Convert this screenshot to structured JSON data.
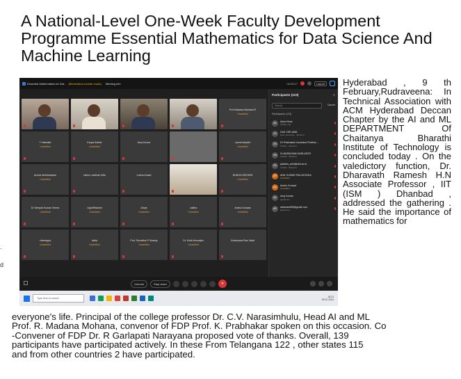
{
  "title": "A National-Level One-Week Faculty Development Programme Essential Mathematics for Data Science And Machine Learning",
  "left_margin_marks": [
    ".",
    "d"
  ],
  "meeting": {
    "window_title": "Essential Mathematics for Dat...",
    "unmute_mode": "(Moderated unmute mode)",
    "meeting_info": "Meeting info",
    "time": "02:03:17",
    "layout_label": "Layout",
    "tiles": [
      {
        "name": "",
        "status": "",
        "kind": "v1"
      },
      {
        "name": "",
        "status": "",
        "kind": "v2"
      },
      {
        "name": "",
        "status": "",
        "kind": "v3"
      },
      {
        "name": "",
        "status": "",
        "kind": "v4"
      },
      {
        "name": "Prof Madana Mohana R",
        "status": "Unverified",
        "kind": "highlight"
      },
      {
        "name": "Y Harinath",
        "status": "Unverified",
        "kind": ""
      },
      {
        "name": "Krupa Suthar",
        "status": "Unverified",
        "kind": ""
      },
      {
        "name": "Anuj Kumar",
        "status": "",
        "kind": ""
      },
      {
        "name": "",
        "status": "",
        "kind": "gray"
      },
      {
        "name": "Laxmi deepthi",
        "status": "Unverified",
        "kind": ""
      },
      {
        "name": "Arunia Mokhanaram",
        "status": "Unverified",
        "kind": ""
      },
      {
        "name": "vishnu vardhan bittu",
        "status": "",
        "kind": ""
      },
      {
        "name": "Lubna Ansari",
        "status": "",
        "kind": ""
      },
      {
        "name": "",
        "status": "",
        "kind": "doll"
      },
      {
        "name": "BUNGA SEKHAR",
        "status": "Unverified",
        "kind": ""
      },
      {
        "name": "Dr Deepak Kumar Verma",
        "status": "Unverified",
        "kind": ""
      },
      {
        "name": "UppiriRashmi",
        "status": "Unverified",
        "kind": ""
      },
      {
        "name": "Divya",
        "status": "Unverified",
        "kind": ""
      },
      {
        "name": "Lalitha",
        "status": "Unverified",
        "kind": ""
      },
      {
        "name": "Anshu Kunwar",
        "status": "Unverified",
        "kind": ""
      },
      {
        "name": "chinnayya",
        "status": "Unverified",
        "kind": ""
      },
      {
        "name": "latha",
        "status": "Unverified",
        "kind": ""
      },
      {
        "name": "Prof. Sumatha R Swamy",
        "status": "Unverified",
        "kind": ""
      },
      {
        "name": "Dr. Kolla Moorajee",
        "status": "Unverified",
        "kind": ""
      },
      {
        "name": "Koteswara Rao Vadd",
        "status": "",
        "kind": ""
      }
    ],
    "participants": {
      "title": "Participants (123)",
      "search_placeholder": "Search",
      "cancel": "Cancel",
      "group_header": "Participants (123)",
      "items": [
        {
          "initials": "AK",
          "name": "Asha Kiran",
          "sub": "Cohost, me",
          "warn": false
        },
        {
          "initials": "HC",
          "name": "HoD CSE-AIML",
          "sub": "Host, presenter · cbit.ac.in",
          "warn": false
        },
        {
          "initials": "DK",
          "name": "Dr Prabhakar Kandukuri Profess...",
          "sub": "Cohost · cbit.ac.in",
          "warn": false
        },
        {
          "initials": "DN",
          "name": "Dr.NARAYANA GARLAPATI",
          "sub": "Cohost · cbit.ac.in",
          "warn": false
        },
        {
          "initials": "PA",
          "name": "pallavis_aiml@cbit.ac.in",
          "sub": "Cohost · cbit.ac.in",
          "warn": false
        },
        {
          "initials": "AP",
          "name": "ANIL KUMAR PALUKONDA",
          "sub": "Unverified",
          "warn": true
        },
        {
          "initials": "AK",
          "name": "Anshu Kunwar",
          "sub": "Unverified",
          "warn": true
        },
        {
          "initials": "AK",
          "name": "Anuj Kumar",
          "sub": "gmail.com",
          "warn": false
        },
        {
          "initials": "AR",
          "name": "artianand95@gmail.com",
          "sub": "gmail.com",
          "warn": false
        }
      ],
      "mute_all": "Mute all",
      "unmute_all": "Unmute all"
    },
    "controls": {
      "unmute": "Unmute",
      "stop_video": "Stop video"
    },
    "taskbar": {
      "search_placeholder": "Type here to search",
      "tray_time": "15:21",
      "tray_date": "09-02-2024"
    }
  },
  "right_paragraph": "Hyderabad , 9 th February,Rudraveena: In Technical Association with ACM Hyderabad Deccan Chapter by the AI and ML DEPARTMENT Of Chaitanya Bharathi Institute of Technology is concluded today . On the valedictory function, Dr. Dharavath Ramesh H.N Associate Professor , IIT (ISM ) Dhanbad , addressed the gathering . He said the importance of mathematics for",
  "bottom_lines": [
    "everyone's life.  Principal of the college professor Dr. C.V. Narasimhulu, Head AI and ML",
    "Prof. R. Madana Mohana, convenor of FDP Prof. K. Prabhakar spoken on this occasion. Co",
    "-Convener of FDP Dr. R Garlapati Narayana proposed vote of thanks. Overall, 139",
    "participants have participated actively.  In these  From Telangana 122 , other states 115",
    "and from other countries 2 have participated."
  ]
}
